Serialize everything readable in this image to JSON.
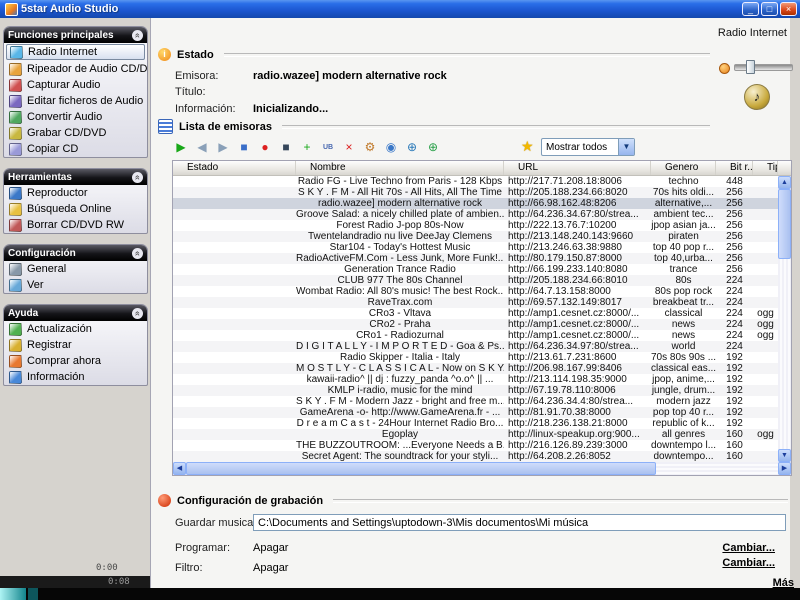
{
  "window": {
    "title": "5star Audio Studio",
    "context_label": "Radio Internet",
    "buttons": {
      "minimize": "_",
      "maximize": "□",
      "close": "×"
    }
  },
  "sidebar": {
    "groups": [
      {
        "title": "Funciones principales",
        "items": [
          {
            "label": "Radio Internet",
            "icon": "radio-internet-icon",
            "color": "#58b6e8",
            "selected": true
          },
          {
            "label": "Ripeador de Audio CD/DVD",
            "icon": "cd-ripper-icon",
            "color": "#e8a33d"
          },
          {
            "label": "Capturar Audio",
            "icon": "capture-audio-icon",
            "color": "#d05050"
          },
          {
            "label": "Editar ficheros de Audio",
            "icon": "edit-audio-icon",
            "color": "#7a68c0"
          },
          {
            "label": "Convertir Audio",
            "icon": "convert-audio-icon",
            "color": "#50a860"
          },
          {
            "label": "Grabar CD/DVD",
            "icon": "burn-cd-icon",
            "color": "#c8b840"
          },
          {
            "label": "Copiar CD",
            "icon": "copy-cd-icon",
            "color": "#9a9ad8"
          }
        ]
      },
      {
        "title": "Herramientas",
        "items": [
          {
            "label": "Reproductor",
            "icon": "player-icon",
            "color": "#3a78c8"
          },
          {
            "label": "Búsqueda Online",
            "icon": "online-search-icon",
            "color": "#e8c040"
          },
          {
            "label": "Borrar CD/DVD RW",
            "icon": "erase-cd-icon",
            "color": "#c05858"
          }
        ]
      },
      {
        "title": "Configuración",
        "items": [
          {
            "label": "General",
            "icon": "general-settings-icon",
            "color": "#8898a8"
          },
          {
            "label": "Ver",
            "icon": "view-settings-icon",
            "color": "#68a8d8"
          }
        ]
      },
      {
        "title": "Ayuda",
        "items": [
          {
            "label": "Actualización",
            "icon": "update-icon",
            "color": "#50b050"
          },
          {
            "label": "Registrar",
            "icon": "register-icon",
            "color": "#d8b030"
          },
          {
            "label": "Comprar ahora",
            "icon": "buy-now-icon",
            "color": "#e87830"
          },
          {
            "label": "Información",
            "icon": "info-icon",
            "color": "#4888d8"
          }
        ]
      }
    ]
  },
  "estado": {
    "section_title": "Estado",
    "fields": [
      {
        "label": "Emisora:",
        "value": "radio.wazee] modern alternative rock"
      },
      {
        "label": "Título:",
        "value": ""
      },
      {
        "label": "Información:",
        "value": "Inicializando..."
      }
    ]
  },
  "lista": {
    "section_title": "Lista de emisoras",
    "filter_value": "Mostrar todos",
    "toolbar": [
      {
        "name": "play-icon",
        "glyph": "▶",
        "color": "#18a818"
      },
      {
        "name": "prev-icon",
        "glyph": "◀",
        "color": "#8aa0b8"
      },
      {
        "name": "next-icon",
        "glyph": "▶",
        "color": "#8aa0b8"
      },
      {
        "name": "open-icon",
        "glyph": "■",
        "color": "#3a6ec8"
      },
      {
        "name": "record-icon",
        "glyph": "●",
        "color": "#dd2020"
      },
      {
        "name": "stop-icon",
        "glyph": "■",
        "color": "#35465a"
      },
      {
        "name": "add-station-icon",
        "glyph": "+",
        "color": "#18a818"
      },
      {
        "name": "add-url-icon",
        "glyph": "UB",
        "color": "#4868b0"
      },
      {
        "name": "delete-station-icon",
        "glyph": "×",
        "color": "#dd2020"
      },
      {
        "name": "properties-icon",
        "glyph": "⚙",
        "color": "#c07828"
      },
      {
        "name": "preview-icon",
        "glyph": "◉",
        "color": "#3a78c8"
      },
      {
        "name": "web-mail-icon",
        "glyph": "⊕",
        "color": "#2878b8"
      },
      {
        "name": "web-globe-icon",
        "glyph": "⊕",
        "color": "#28a048"
      }
    ],
    "favorites_icon": "★",
    "columns": [
      "Estado",
      "Nombre",
      "URL",
      "Genero",
      "Bit r...",
      "Tipo"
    ],
    "rows": [
      {
        "estado": "",
        "nombre": "Radio FG - Live Techno from Paris - 128 Kbps",
        "url": "http://217.71.208.18:8006",
        "genero": "techno",
        "bit": "448",
        "tipo": ""
      },
      {
        "estado": "",
        "nombre": "S K Y . F M - All Hit 70s - All Hits, All The Time",
        "url": "http://205.188.234.66:8020",
        "genero": "70s hits oldi...",
        "bit": "256",
        "tipo": ""
      },
      {
        "estado": "",
        "nombre": "radio.wazee] modern alternative rock",
        "url": "http://66.98.162.48:8206",
        "genero": "alternative,...",
        "bit": "256",
        "tipo": "",
        "selected": true
      },
      {
        "estado": "",
        "nombre": "Groove Salad: a nicely chilled plate of ambien...",
        "url": "http://64.236.34.67:80/strea...",
        "genero": "ambient tec...",
        "bit": "256",
        "tipo": ""
      },
      {
        "estado": "",
        "nombre": "Forest Radio J-pop 80s-Now",
        "url": "http://222.13.76.7:10200",
        "genero": "jpop asian ja...",
        "bit": "256",
        "tipo": ""
      },
      {
        "estado": "",
        "nombre": "Twentelandradio nu live DeeJay Clemens",
        "url": "http://213.148.240.143:9660",
        "genero": "piraten",
        "bit": "256",
        "tipo": ""
      },
      {
        "estado": "",
        "nombre": "Star104 - Today's Hottest Music",
        "url": "http://213.246.63.38:9880",
        "genero": "top 40 pop r...",
        "bit": "256",
        "tipo": ""
      },
      {
        "estado": "",
        "nombre": "RadioActiveFM.Com - Less Junk, More Funk!...",
        "url": "http://80.179.150.87:8000",
        "genero": "top 40,urba...",
        "bit": "256",
        "tipo": ""
      },
      {
        "estado": "",
        "nombre": "Generation Trance Radio",
        "url": "http://66.199.233.140:8080",
        "genero": "trance",
        "bit": "256",
        "tipo": ""
      },
      {
        "estado": "",
        "nombre": "CLUB 977 The 80s Channel",
        "url": "http://205.188.234.66:8010",
        "genero": "80s",
        "bit": "224",
        "tipo": ""
      },
      {
        "estado": "",
        "nombre": "Wombat Radio: All 80's music! The best Rock...",
        "url": "http://64.7.13.158:8000",
        "genero": "80s pop rock",
        "bit": "224",
        "tipo": ""
      },
      {
        "estado": "",
        "nombre": "RaveTrax.com",
        "url": "http://69.57.132.149:8017",
        "genero": "breakbeat tr...",
        "bit": "224",
        "tipo": ""
      },
      {
        "estado": "",
        "nombre": "CRo3 - Vltava",
        "url": "http://amp1.cesnet.cz:8000/...",
        "genero": "classical",
        "bit": "224",
        "tipo": "ogg"
      },
      {
        "estado": "",
        "nombre": "CRo2 - Praha",
        "url": "http://amp1.cesnet.cz:8000/...",
        "genero": "news",
        "bit": "224",
        "tipo": "ogg"
      },
      {
        "estado": "",
        "nombre": "CRo1 - Radiozurnal",
        "url": "http://amp1.cesnet.cz:8000/...",
        "genero": "news",
        "bit": "224",
        "tipo": "ogg"
      },
      {
        "estado": "",
        "nombre": "D I G I T A L L Y - I M P O R T E D - Goa & Ps...",
        "url": "http://64.236.34.97:80/strea...",
        "genero": "world",
        "bit": "224",
        "tipo": ""
      },
      {
        "estado": "",
        "nombre": "Radio Skipper - Italia - Italy",
        "url": "http://213.61.7.231:8600",
        "genero": "70s 80s 90s ...",
        "bit": "192",
        "tipo": ""
      },
      {
        "estado": "",
        "nombre": "M O S T L Y - C L A S S I C A L - Now on S K Y...",
        "url": "http://206.98.167.99:8406",
        "genero": "classical eas...",
        "bit": "192",
        "tipo": ""
      },
      {
        "estado": "",
        "nombre": "kawaii-radio^ || dj : fuzzy_panda ^o.o^ || ...",
        "url": "http://213.114.198.35:9000",
        "genero": "jpop, anime,...",
        "bit": "192",
        "tipo": ""
      },
      {
        "estado": "",
        "nombre": "KMLP i-radio, music for the mind",
        "url": "http://67.19.78.110:8006",
        "genero": "jungle, drum...",
        "bit": "192",
        "tipo": ""
      },
      {
        "estado": "",
        "nombre": "S K Y . F M - Modern Jazz - bright and free m...",
        "url": "http://64.236.34.4:80/strea...",
        "genero": "modern jazz",
        "bit": "192",
        "tipo": ""
      },
      {
        "estado": "",
        "nombre": "GameArena -o- http://www.GameArena.fr - ...",
        "url": "http://81.91.70.38:8000",
        "genero": "pop top 40 r...",
        "bit": "192",
        "tipo": ""
      },
      {
        "estado": "",
        "nombre": "D r e a m C a s t - 24Hour Internet Radio Bro...",
        "url": "http://218.236.138.21:8000",
        "genero": "republic of k...",
        "bit": "192",
        "tipo": ""
      },
      {
        "estado": "",
        "nombre": "Egoplay",
        "url": "http://linux-speakup.org:900...",
        "genero": "all genres",
        "bit": "160",
        "tipo": "ogg"
      },
      {
        "estado": "",
        "nombre": "THE BUZZOUTROOM: ...Everyone Needs a B...",
        "url": "http://216.126.89.239:3000",
        "genero": "downtempo l...",
        "bit": "160",
        "tipo": ""
      },
      {
        "estado": "",
        "nombre": "Secret Agent: The soundtrack for your styli...",
        "url": "http://64.208.2.26:8052",
        "genero": "downtempo...",
        "bit": "160",
        "tipo": ""
      }
    ]
  },
  "grabacion": {
    "section_title": "Configuración de grabación",
    "save_label": "Guardar musica en:",
    "save_path": "C:\\Documents and Settings\\uptodown-3\\Mis documentos\\Mi música",
    "programar_label": "Programar:",
    "programar_value": "Apagar",
    "filtro_label": "Filtro:",
    "filtro_value": "Apagar",
    "cambiar_label": "Cambiar...",
    "mas_label": "Más"
  },
  "player": {
    "time_elapsed": "0:00",
    "time_total": "0:08"
  },
  "colors": {
    "titlebar_blue": "#1b55cf",
    "selection_gray": "#cfd4de",
    "accent_teal": "#12848c"
  }
}
